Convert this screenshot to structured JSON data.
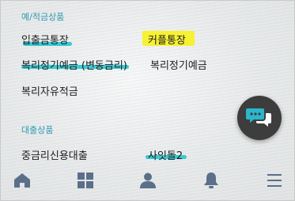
{
  "sections": {
    "deposit_title": "예/적금상품",
    "loan_title": "대출상품"
  },
  "deposit_items": [
    "입출금통장",
    "커플통장",
    "복리정기예금 (변동금리)",
    "복리정기예금",
    "복리자유적금"
  ],
  "loan_items": [
    "중금리신용대출",
    "사잇돌2"
  ],
  "colors": {
    "accent_teal": "#19c4cf",
    "highlight_yellow": "#f7f133",
    "section_title": "#2f9bb0",
    "tab_icon": "#5b6f8a",
    "fab_bg": "#3d3d3d",
    "fab_icon": "#2bb6cc"
  },
  "icons": {
    "chat_fab": "chat-bubbles-icon",
    "tabs": [
      "home-icon",
      "grid-icon",
      "person-icon",
      "bell-icon",
      "menu-icon"
    ]
  }
}
